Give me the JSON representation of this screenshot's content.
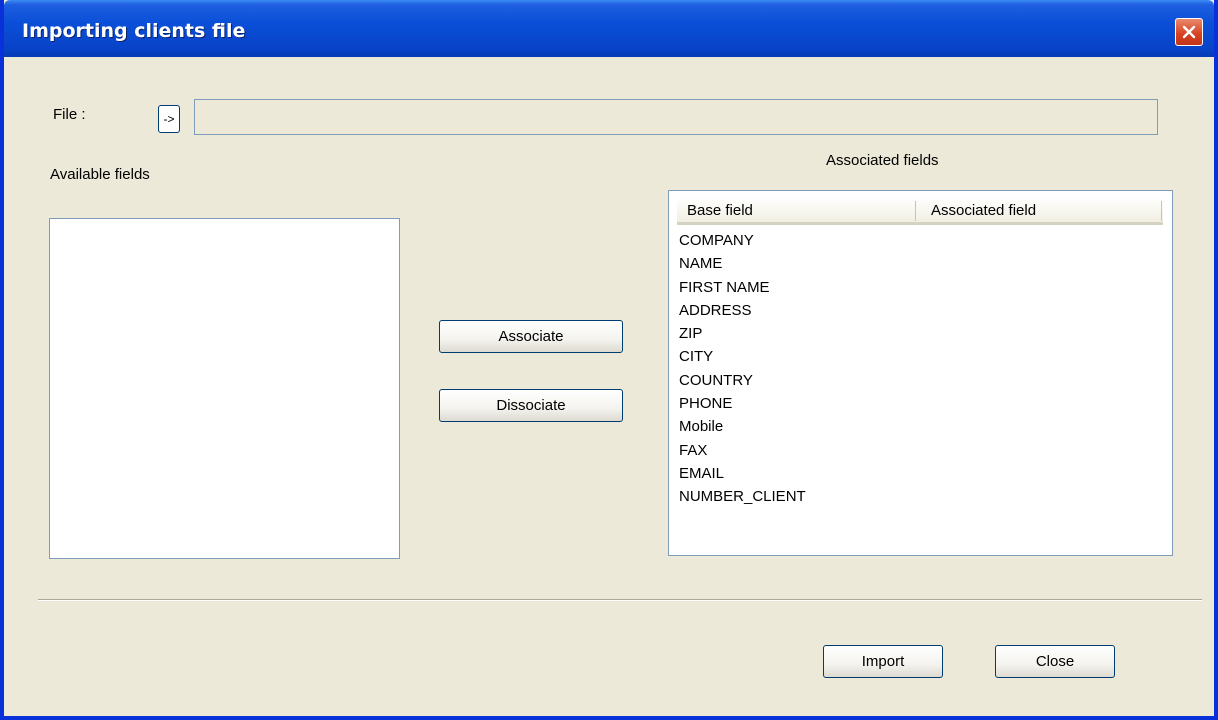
{
  "window": {
    "title": "Importing clients file"
  },
  "file": {
    "label": "File :",
    "browse_label": "->",
    "value": ""
  },
  "available": {
    "label": "Available fields",
    "items": []
  },
  "actions": {
    "associate_label": "Associate",
    "dissociate_label": "Dissociate"
  },
  "associated": {
    "label": "Associated fields",
    "columns": [
      "Base field",
      "Associated field"
    ],
    "rows": [
      {
        "base": "COMPANY",
        "assoc": ""
      },
      {
        "base": "NAME",
        "assoc": ""
      },
      {
        "base": "FIRST NAME",
        "assoc": ""
      },
      {
        "base": "ADDRESS",
        "assoc": ""
      },
      {
        "base": "ZIP",
        "assoc": ""
      },
      {
        "base": "CITY",
        "assoc": ""
      },
      {
        "base": "COUNTRY",
        "assoc": ""
      },
      {
        "base": "PHONE",
        "assoc": ""
      },
      {
        "base": "Mobile",
        "assoc": ""
      },
      {
        "base": "FAX",
        "assoc": ""
      },
      {
        "base": "EMAIL",
        "assoc": ""
      },
      {
        "base": "NUMBER_CLIENT",
        "assoc": ""
      }
    ]
  },
  "footer": {
    "import_label": "Import",
    "close_label": "Close"
  },
  "colors": {
    "titlebar": "#0a4fd8",
    "window_bg": "#ece9d8",
    "close_button": "#d6401f"
  }
}
